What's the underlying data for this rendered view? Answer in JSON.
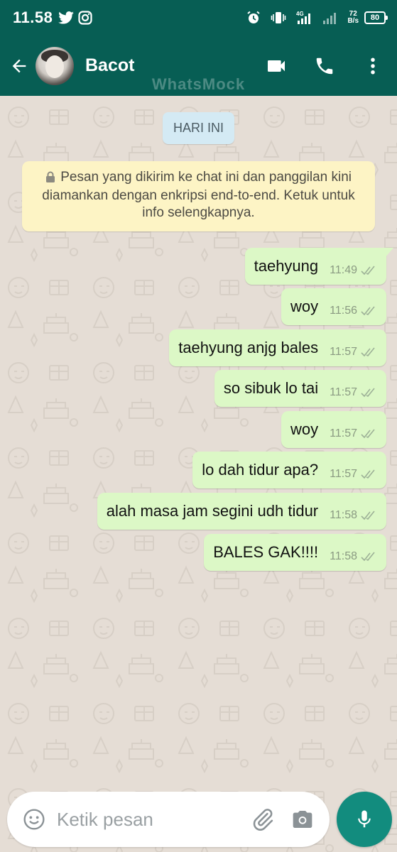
{
  "status_bar": {
    "time": "11.58",
    "icons": [
      "twitter-icon",
      "instagram-icon",
      "alarm-icon",
      "vibrate-icon",
      "signal-4g-icon",
      "signal-icon"
    ],
    "net_speed_value": "72",
    "net_speed_unit": "B/s",
    "battery": "80"
  },
  "header": {
    "back_icon": "arrow-left-icon",
    "contact_name": "Bacot",
    "watermark": "WhatsMock",
    "actions": [
      "video-call-icon",
      "voice-call-icon",
      "more-vert-icon"
    ]
  },
  "chat": {
    "date_chip": "HARI INI",
    "encryption_notice": "Pesan yang dikirim ke chat ini dan panggilan kini diamankan dengan enkripsi end-to-end. Ketuk untuk info selengkapnya.",
    "messages": [
      {
        "text": "taehyung",
        "time": "11:49",
        "status": "delivered"
      },
      {
        "text": "woy",
        "time": "11:56",
        "status": "delivered"
      },
      {
        "text": "taehyung anjg bales",
        "time": "11:57",
        "status": "delivered"
      },
      {
        "text": "so sibuk lo tai",
        "time": "11:57",
        "status": "delivered"
      },
      {
        "text": "woy",
        "time": "11:57",
        "status": "delivered"
      },
      {
        "text": "lo dah tidur apa?",
        "time": "11:57",
        "status": "delivered"
      },
      {
        "text": "alah masa jam segini udh tidur",
        "time": "11:58",
        "status": "delivered"
      },
      {
        "text": "BALES GAK!!!!",
        "time": "11:58",
        "status": "delivered"
      }
    ]
  },
  "composer": {
    "placeholder": "Ketik pesan",
    "icons": [
      "emoji-icon",
      "attach-icon",
      "camera-icon"
    ],
    "send_icon": "mic-icon"
  },
  "colors": {
    "header": "#075e54",
    "chat_background": "#e5ddd5",
    "outgoing_bubble": "#dcf8c6",
    "mic_button": "#128c7e",
    "date_chip": "#d4eaf4",
    "encryption_notice": "#fdf4c5"
  }
}
